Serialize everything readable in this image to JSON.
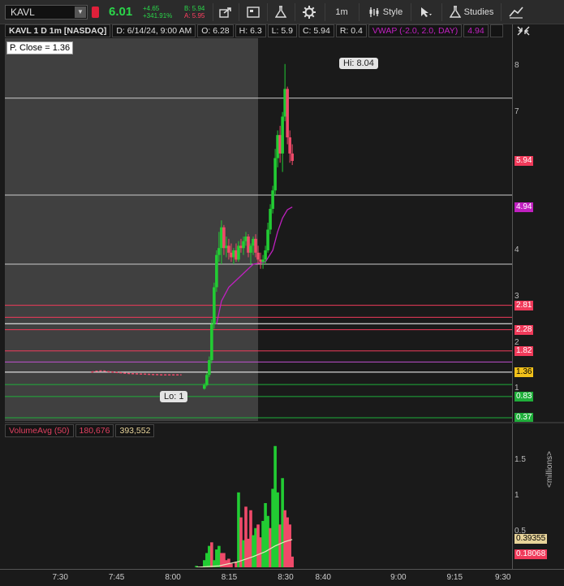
{
  "toolbar": {
    "symbol": "KAVL",
    "last_price": "6.01",
    "net_change": "+4.65",
    "pct_change": "+341.91%",
    "bid": "B: 5.94",
    "ask": "A: 5.95",
    "timeframe_label": "1m",
    "style_label": "Style",
    "studies_label": "Studies",
    "icons": [
      "share-icon",
      "chart-settings-icon",
      "flask-icon",
      "gear-icon",
      "style-icon",
      "cursor-icon",
      "studies-icon",
      "drawing-icon"
    ]
  },
  "info_bar": {
    "title": "KAVL 1 D 1m [NASDAQ]",
    "date": "D: 6/14/24, 9:00 AM",
    "open": "O: 6.28",
    "high": "H: 6.3",
    "low": "L: 5.9",
    "close": "C: 5.94",
    "range": "R: 0.4",
    "vwap_label": "VWAP (-2.0, 2.0, DAY)",
    "vwap_value": "4.94"
  },
  "annotations": {
    "prev_close": "P. Close = 1.36",
    "high_callout": "Hi: 8.04",
    "low_callout": "Lo: 1"
  },
  "price_axis": {
    "ticks": [
      "8",
      "7",
      "4",
      "3",
      "2",
      "1"
    ],
    "badges": [
      {
        "label": "5.94",
        "value": 5.94,
        "bg": "#f03a5a",
        "fg": "#ffffff"
      },
      {
        "label": "4.94",
        "value": 4.94,
        "bg": "#c020c0",
        "fg": "#ffffff"
      },
      {
        "label": "2.81",
        "value": 2.81,
        "bg": "#f03a5a",
        "fg": "#ffffff"
      },
      {
        "label": "2.28",
        "value": 2.28,
        "bg": "#f03a5a",
        "fg": "#ffffff"
      },
      {
        "label": "1.82",
        "value": 1.82,
        "bg": "#f03a5a",
        "fg": "#ffffff"
      },
      {
        "label": "1.36",
        "value": 1.36,
        "bg": "#f2c11a",
        "fg": "#000000"
      },
      {
        "label": "0.83",
        "value": 0.83,
        "bg": "#1fae3a",
        "fg": "#ffffff"
      },
      {
        "label": "0.37",
        "value": 0.37,
        "bg": "#1fae3a",
        "fg": "#ffffff"
      }
    ]
  },
  "volume_pane": {
    "name": "VolumeAvg (50)",
    "value1": "180,676",
    "value2": "393,552",
    "ticks": [
      "1.5",
      "1",
      "0.5"
    ],
    "units": "<millions>",
    "badges": [
      {
        "label": "0.39355",
        "value": 0.39355,
        "bg": "#e8d49a",
        "fg": "#000000"
      },
      {
        "label": "0.18068",
        "value": 0.18068,
        "bg": "#f03a5a",
        "fg": "#ffffff"
      }
    ]
  },
  "time_axis": {
    "labels": [
      "7:30",
      "7:45",
      "8:00",
      "8:15",
      "8:30",
      "8:40",
      "9:00",
      "9:15",
      "9:30"
    ]
  },
  "colors": {
    "up": "#22cc33",
    "down": "#f04a6a",
    "vwap": "#c020c0",
    "vol_avg": "#e8e8c0"
  },
  "chart_data": {
    "type": "candlestick",
    "price_ylim": [
      0.3,
      8.6
    ],
    "volume_ylim": [
      0,
      1.8
    ],
    "horizontal_levels": [
      {
        "value": 7.3,
        "color": "#cccccc"
      },
      {
        "value": 5.2,
        "color": "#cccccc"
      },
      {
        "value": 3.7,
        "color": "#cccccc"
      },
      {
        "value": 2.81,
        "color": "#f03a5a"
      },
      {
        "value": 2.55,
        "color": "#f03a5a"
      },
      {
        "value": 2.41,
        "color": "#ffffff"
      },
      {
        "value": 2.28,
        "color": "#f03a5a"
      },
      {
        "value": 1.82,
        "color": "#f03a5a"
      },
      {
        "value": 1.58,
        "color": "#c050d0"
      },
      {
        "value": 1.36,
        "color": "#ffffff"
      },
      {
        "value": 1.09,
        "color": "#1fae3a"
      },
      {
        "value": 0.83,
        "color": "#1fae3a"
      },
      {
        "value": 0.37,
        "color": "#1fae3a"
      }
    ],
    "candles": [
      {
        "t": 8.1,
        "o": 1.0,
        "h": 1.12,
        "l": 0.98,
        "c": 1.08
      },
      {
        "t": 8.75,
        "o": 1.08,
        "h": 1.35,
        "l": 1.05,
        "c": 1.3
      },
      {
        "t": 9.4,
        "o": 1.3,
        "h": 1.7,
        "l": 1.25,
        "c": 1.62
      },
      {
        "t": 10.05,
        "o": 1.62,
        "h": 2.5,
        "l": 1.55,
        "c": 2.4
      },
      {
        "t": 10.7,
        "o": 2.4,
        "h": 3.3,
        "l": 2.3,
        "c": 3.2
      },
      {
        "t": 11.35,
        "o": 3.2,
        "h": 4.0,
        "l": 3.1,
        "c": 3.9
      },
      {
        "t": 12.0,
        "o": 3.9,
        "h": 4.4,
        "l": 3.75,
        "c": 4.05
      },
      {
        "t": 12.65,
        "o": 4.05,
        "h": 4.65,
        "l": 3.7,
        "c": 4.5
      },
      {
        "t": 13.3,
        "o": 4.5,
        "h": 4.55,
        "l": 3.9,
        "c": 4.05
      },
      {
        "t": 13.95,
        "o": 4.05,
        "h": 4.3,
        "l": 3.85,
        "c": 4.1
      },
      {
        "t": 14.6,
        "o": 4.1,
        "h": 4.25,
        "l": 3.8,
        "c": 3.95
      },
      {
        "t": 15.25,
        "o": 3.95,
        "h": 4.15,
        "l": 3.75,
        "c": 3.85
      },
      {
        "t": 15.9,
        "o": 3.85,
        "h": 4.05,
        "l": 3.7,
        "c": 4.0
      },
      {
        "t": 16.55,
        "o": 4.0,
        "h": 4.15,
        "l": 3.75,
        "c": 3.8
      },
      {
        "t": 17.2,
        "o": 3.8,
        "h": 4.2,
        "l": 3.75,
        "c": 4.1
      },
      {
        "t": 17.85,
        "o": 4.1,
        "h": 4.25,
        "l": 3.95,
        "c": 4.05
      },
      {
        "t": 18.5,
        "o": 4.05,
        "h": 4.3,
        "l": 3.9,
        "c": 4.2
      },
      {
        "t": 19.15,
        "o": 4.2,
        "h": 4.4,
        "l": 4.1,
        "c": 4.3
      },
      {
        "t": 19.8,
        "o": 4.3,
        "h": 4.35,
        "l": 3.85,
        "c": 3.95
      },
      {
        "t": 20.45,
        "o": 3.95,
        "h": 4.15,
        "l": 3.7,
        "c": 4.1
      },
      {
        "t": 21.1,
        "o": 4.1,
        "h": 4.3,
        "l": 3.9,
        "c": 4.25
      },
      {
        "t": 21.75,
        "o": 4.25,
        "h": 4.35,
        "l": 3.85,
        "c": 3.95
      },
      {
        "t": 22.4,
        "o": 3.95,
        "h": 4.1,
        "l": 3.7,
        "c": 3.8
      },
      {
        "t": 23.05,
        "o": 3.8,
        "h": 3.95,
        "l": 3.6,
        "c": 3.75
      },
      {
        "t": 23.7,
        "o": 3.75,
        "h": 3.9,
        "l": 3.6,
        "c": 3.8
      },
      {
        "t": 24.35,
        "o": 3.8,
        "h": 4.1,
        "l": 3.7,
        "c": 4.0
      },
      {
        "t": 25.0,
        "o": 4.0,
        "h": 4.6,
        "l": 3.95,
        "c": 4.45
      },
      {
        "t": 25.65,
        "o": 4.45,
        "h": 5.0,
        "l": 4.35,
        "c": 4.9
      },
      {
        "t": 26.3,
        "o": 4.9,
        "h": 5.4,
        "l": 4.8,
        "c": 5.3
      },
      {
        "t": 26.95,
        "o": 5.3,
        "h": 6.2,
        "l": 5.2,
        "c": 6.0
      },
      {
        "t": 27.6,
        "o": 6.0,
        "h": 6.6,
        "l": 5.8,
        "c": 6.5
      },
      {
        "t": 28.25,
        "o": 6.5,
        "h": 6.7,
        "l": 5.9,
        "c": 6.1
      },
      {
        "t": 28.9,
        "o": 6.1,
        "h": 7.0,
        "l": 5.7,
        "c": 6.9
      },
      {
        "t": 29.55,
        "o": 6.9,
        "h": 8.04,
        "l": 6.8,
        "c": 7.5
      },
      {
        "t": 30.2,
        "o": 7.5,
        "h": 7.55,
        "l": 6.3,
        "c": 6.45
      },
      {
        "t": 30.85,
        "o": 6.45,
        "h": 6.6,
        "l": 5.9,
        "c": 6.1
      },
      {
        "t": 31.5,
        "o": 6.1,
        "h": 6.3,
        "l": 5.85,
        "c": 5.94
      }
    ],
    "pre_market_prices": [
      {
        "t": -22.0,
        "p": 1.36
      },
      {
        "t": -20.5,
        "p": 1.38
      },
      {
        "t": -19.0,
        "p": 1.39
      },
      {
        "t": -17.5,
        "p": 1.37
      },
      {
        "t": -12.0,
        "p": 1.33
      },
      {
        "t": -3.0,
        "p": 1.3
      },
      {
        "t": 2.0,
        "p": 1.3
      }
    ],
    "vwap": [
      {
        "t": 11.35,
        "v": 2.4
      },
      {
        "t": 12.65,
        "v": 2.9
      },
      {
        "t": 14.6,
        "v": 3.2
      },
      {
        "t": 17.85,
        "v": 3.45
      },
      {
        "t": 21.1,
        "v": 3.7
      },
      {
        "t": 24.35,
        "v": 3.75
      },
      {
        "t": 26.3,
        "v": 4.0
      },
      {
        "t": 27.6,
        "v": 4.4
      },
      {
        "t": 28.9,
        "v": 4.7
      },
      {
        "t": 30.2,
        "v": 4.88
      },
      {
        "t": 31.5,
        "v": 4.94
      }
    ],
    "volume": [
      {
        "t": 6.0,
        "v": 0.02,
        "up": true
      },
      {
        "t": 8.1,
        "v": 0.1,
        "up": true
      },
      {
        "t": 8.75,
        "v": 0.2,
        "up": true
      },
      {
        "t": 9.4,
        "v": 0.3,
        "up": true
      },
      {
        "t": 10.05,
        "v": 0.35,
        "up": false
      },
      {
        "t": 10.7,
        "v": 0.1,
        "up": true
      },
      {
        "t": 11.35,
        "v": 0.25,
        "up": true
      },
      {
        "t": 12.0,
        "v": 0.3,
        "up": true
      },
      {
        "t": 12.65,
        "v": 0.2,
        "up": false
      },
      {
        "t": 13.3,
        "v": 0.2,
        "up": false
      },
      {
        "t": 13.95,
        "v": 0.1,
        "up": false
      },
      {
        "t": 14.6,
        "v": 0.12,
        "up": false
      },
      {
        "t": 15.25,
        "v": 0.05,
        "up": false
      },
      {
        "t": 16.55,
        "v": 0.08,
        "up": false
      },
      {
        "t": 17.2,
        "v": 1.05,
        "up": true
      },
      {
        "t": 17.85,
        "v": 0.7,
        "up": false
      },
      {
        "t": 18.5,
        "v": 0.38,
        "up": true
      },
      {
        "t": 19.15,
        "v": 0.85,
        "up": false
      },
      {
        "t": 19.8,
        "v": 0.4,
        "up": false
      },
      {
        "t": 20.45,
        "v": 0.8,
        "up": false
      },
      {
        "t": 21.1,
        "v": 0.45,
        "up": true
      },
      {
        "t": 21.75,
        "v": 0.55,
        "up": true
      },
      {
        "t": 22.4,
        "v": 0.6,
        "up": false
      },
      {
        "t": 23.05,
        "v": 0.42,
        "up": false
      },
      {
        "t": 23.7,
        "v": 0.65,
        "up": true
      },
      {
        "t": 24.35,
        "v": 0.9,
        "up": true
      },
      {
        "t": 25.0,
        "v": 0.72,
        "up": true
      },
      {
        "t": 25.65,
        "v": 0.55,
        "up": false
      },
      {
        "t": 26.3,
        "v": 1.1,
        "up": true
      },
      {
        "t": 26.95,
        "v": 1.7,
        "up": true
      },
      {
        "t": 27.6,
        "v": 1.05,
        "up": true
      },
      {
        "t": 28.25,
        "v": 0.6,
        "up": false
      },
      {
        "t": 28.9,
        "v": 1.25,
        "up": true
      },
      {
        "t": 29.55,
        "v": 0.8,
        "up": false
      },
      {
        "t": 30.2,
        "v": 0.7,
        "up": false
      },
      {
        "t": 30.85,
        "v": 0.6,
        "up": false
      },
      {
        "t": 31.5,
        "v": 0.15,
        "up": false
      }
    ],
    "volume_avg": [
      {
        "t": 6.0,
        "v": 0.0
      },
      {
        "t": 12.0,
        "v": 0.02
      },
      {
        "t": 17.2,
        "v": 0.08
      },
      {
        "t": 21.1,
        "v": 0.15
      },
      {
        "t": 24.35,
        "v": 0.22
      },
      {
        "t": 26.95,
        "v": 0.3
      },
      {
        "t": 29.55,
        "v": 0.36
      },
      {
        "t": 31.5,
        "v": 0.39
      }
    ]
  }
}
